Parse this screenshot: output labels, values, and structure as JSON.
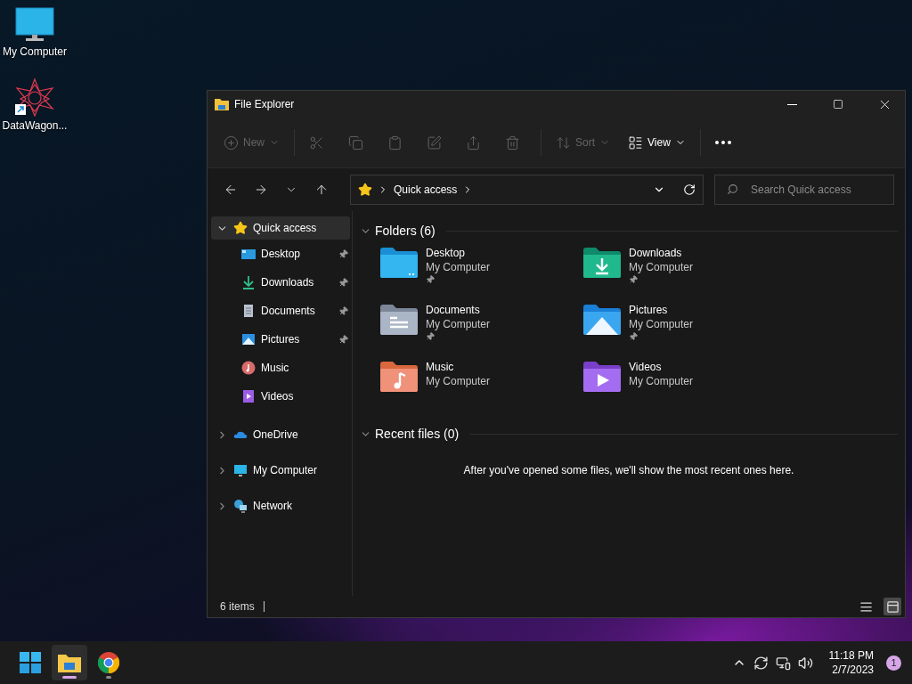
{
  "desktop": {
    "icons": [
      {
        "kind": "computer",
        "label": "My Computer"
      },
      {
        "kind": "app-shortcut",
        "label": "DataWagon..."
      }
    ]
  },
  "window": {
    "title": "File Explorer",
    "toolbar": [
      {
        "kind": "new",
        "label": "New",
        "disabled": true,
        "menu": true
      },
      {
        "kind": "cut",
        "disabled": true
      },
      {
        "kind": "copy",
        "disabled": true
      },
      {
        "kind": "paste",
        "disabled": true
      },
      {
        "kind": "rename",
        "disabled": true
      },
      {
        "kind": "share",
        "disabled": true
      },
      {
        "kind": "delete",
        "disabled": true
      },
      {
        "kind": "sort",
        "label": "Sort",
        "disabled": true,
        "menu": true
      },
      {
        "kind": "view",
        "label": "View",
        "disabled": false,
        "menu": true
      },
      {
        "kind": "more",
        "disabled": false
      }
    ],
    "address": {
      "location": "Quick access"
    },
    "search": {
      "placeholder": "Search Quick access"
    },
    "sidebar": {
      "items": [
        {
          "kind": "star",
          "label": "Quick access",
          "expanded": true,
          "selected": true,
          "children": [
            {
              "kind": "desktop",
              "label": "Desktop",
              "pinned": true,
              "selected": false
            },
            {
              "kind": "downloads",
              "label": "Downloads",
              "pinned": true,
              "selected": false
            },
            {
              "kind": "documents",
              "label": "Documents",
              "pinned": true,
              "selected": false
            },
            {
              "kind": "pictures",
              "label": "Pictures",
              "pinned": true,
              "selected": false
            },
            {
              "kind": "music",
              "label": "Music",
              "pinned": false,
              "selected": false
            },
            {
              "kind": "videos",
              "label": "Videos",
              "pinned": false,
              "selected": false
            }
          ]
        },
        {
          "kind": "cloud",
          "label": "OneDrive",
          "expanded": false,
          "selected": false
        },
        {
          "kind": "computer",
          "label": "My Computer",
          "expanded": false,
          "selected": false
        },
        {
          "kind": "network",
          "label": "Network",
          "expanded": false,
          "selected": false
        }
      ]
    },
    "folders": {
      "title": "Folders (6)",
      "expanded": true,
      "items": [
        {
          "kind": "desktop",
          "name": "Desktop",
          "location": "My Computer",
          "pinned": true
        },
        {
          "kind": "downloads",
          "name": "Downloads",
          "location": "My Computer",
          "pinned": true
        },
        {
          "kind": "documents",
          "name": "Documents",
          "location": "My Computer",
          "pinned": true
        },
        {
          "kind": "pictures",
          "name": "Pictures",
          "location": "My Computer",
          "pinned": true
        },
        {
          "kind": "music",
          "name": "Music",
          "location": "My Computer",
          "pinned": false
        },
        {
          "kind": "videos",
          "name": "Videos",
          "location": "My Computer",
          "pinned": false
        }
      ]
    },
    "recent": {
      "title": "Recent files (0)",
      "expanded": true,
      "message": "After you've opened some files, we'll show the most recent ones here."
    },
    "status": {
      "count": "6 items",
      "views": [
        {
          "kind": "details",
          "selected": false
        },
        {
          "kind": "tiles",
          "selected": true
        }
      ]
    }
  },
  "taskbar": {
    "apps": [
      {
        "kind": "explorer",
        "selected": true
      },
      {
        "kind": "browser",
        "selected": false
      }
    ],
    "time": "11:18 PM",
    "date": "2/7/2023",
    "notifications": "1"
  }
}
